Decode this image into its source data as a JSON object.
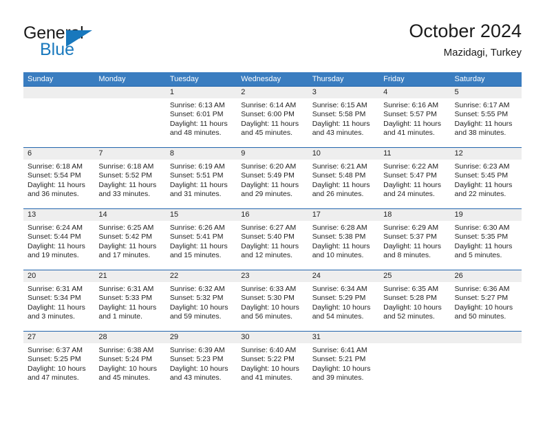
{
  "brand": {
    "line1": "General",
    "line2": "Blue",
    "accent_color": "#1878bd",
    "flag_icon": "flag-triangle-icon"
  },
  "header": {
    "title": "October 2024",
    "subtitle": "Mazidagi, Turkey"
  },
  "colors": {
    "header_bar": "#3a7dc0",
    "row_divider": "#1f62ab",
    "date_band": "#eeeeee",
    "text": "#222222"
  },
  "weekdays": [
    "Sunday",
    "Monday",
    "Tuesday",
    "Wednesday",
    "Thursday",
    "Friday",
    "Saturday"
  ],
  "weeks": [
    [
      {
        "day": "",
        "empty": true
      },
      {
        "day": "",
        "empty": true
      },
      {
        "day": "1",
        "sunrise": "Sunrise: 6:13 AM",
        "sunset": "Sunset: 6:01 PM",
        "daylight": "Daylight: 11 hours and 48 minutes."
      },
      {
        "day": "2",
        "sunrise": "Sunrise: 6:14 AM",
        "sunset": "Sunset: 6:00 PM",
        "daylight": "Daylight: 11 hours and 45 minutes."
      },
      {
        "day": "3",
        "sunrise": "Sunrise: 6:15 AM",
        "sunset": "Sunset: 5:58 PM",
        "daylight": "Daylight: 11 hours and 43 minutes."
      },
      {
        "day": "4",
        "sunrise": "Sunrise: 6:16 AM",
        "sunset": "Sunset: 5:57 PM",
        "daylight": "Daylight: 11 hours and 41 minutes."
      },
      {
        "day": "5",
        "sunrise": "Sunrise: 6:17 AM",
        "sunset": "Sunset: 5:55 PM",
        "daylight": "Daylight: 11 hours and 38 minutes."
      }
    ],
    [
      {
        "day": "6",
        "sunrise": "Sunrise: 6:18 AM",
        "sunset": "Sunset: 5:54 PM",
        "daylight": "Daylight: 11 hours and 36 minutes."
      },
      {
        "day": "7",
        "sunrise": "Sunrise: 6:18 AM",
        "sunset": "Sunset: 5:52 PM",
        "daylight": "Daylight: 11 hours and 33 minutes."
      },
      {
        "day": "8",
        "sunrise": "Sunrise: 6:19 AM",
        "sunset": "Sunset: 5:51 PM",
        "daylight": "Daylight: 11 hours and 31 minutes."
      },
      {
        "day": "9",
        "sunrise": "Sunrise: 6:20 AM",
        "sunset": "Sunset: 5:49 PM",
        "daylight": "Daylight: 11 hours and 29 minutes."
      },
      {
        "day": "10",
        "sunrise": "Sunrise: 6:21 AM",
        "sunset": "Sunset: 5:48 PM",
        "daylight": "Daylight: 11 hours and 26 minutes."
      },
      {
        "day": "11",
        "sunrise": "Sunrise: 6:22 AM",
        "sunset": "Sunset: 5:47 PM",
        "daylight": "Daylight: 11 hours and 24 minutes."
      },
      {
        "day": "12",
        "sunrise": "Sunrise: 6:23 AM",
        "sunset": "Sunset: 5:45 PM",
        "daylight": "Daylight: 11 hours and 22 minutes."
      }
    ],
    [
      {
        "day": "13",
        "sunrise": "Sunrise: 6:24 AM",
        "sunset": "Sunset: 5:44 PM",
        "daylight": "Daylight: 11 hours and 19 minutes."
      },
      {
        "day": "14",
        "sunrise": "Sunrise: 6:25 AM",
        "sunset": "Sunset: 5:42 PM",
        "daylight": "Daylight: 11 hours and 17 minutes."
      },
      {
        "day": "15",
        "sunrise": "Sunrise: 6:26 AM",
        "sunset": "Sunset: 5:41 PM",
        "daylight": "Daylight: 11 hours and 15 minutes."
      },
      {
        "day": "16",
        "sunrise": "Sunrise: 6:27 AM",
        "sunset": "Sunset: 5:40 PM",
        "daylight": "Daylight: 11 hours and 12 minutes."
      },
      {
        "day": "17",
        "sunrise": "Sunrise: 6:28 AM",
        "sunset": "Sunset: 5:38 PM",
        "daylight": "Daylight: 11 hours and 10 minutes."
      },
      {
        "day": "18",
        "sunrise": "Sunrise: 6:29 AM",
        "sunset": "Sunset: 5:37 PM",
        "daylight": "Daylight: 11 hours and 8 minutes."
      },
      {
        "day": "19",
        "sunrise": "Sunrise: 6:30 AM",
        "sunset": "Sunset: 5:35 PM",
        "daylight": "Daylight: 11 hours and 5 minutes."
      }
    ],
    [
      {
        "day": "20",
        "sunrise": "Sunrise: 6:31 AM",
        "sunset": "Sunset: 5:34 PM",
        "daylight": "Daylight: 11 hours and 3 minutes."
      },
      {
        "day": "21",
        "sunrise": "Sunrise: 6:31 AM",
        "sunset": "Sunset: 5:33 PM",
        "daylight": "Daylight: 11 hours and 1 minute."
      },
      {
        "day": "22",
        "sunrise": "Sunrise: 6:32 AM",
        "sunset": "Sunset: 5:32 PM",
        "daylight": "Daylight: 10 hours and 59 minutes."
      },
      {
        "day": "23",
        "sunrise": "Sunrise: 6:33 AM",
        "sunset": "Sunset: 5:30 PM",
        "daylight": "Daylight: 10 hours and 56 minutes."
      },
      {
        "day": "24",
        "sunrise": "Sunrise: 6:34 AM",
        "sunset": "Sunset: 5:29 PM",
        "daylight": "Daylight: 10 hours and 54 minutes."
      },
      {
        "day": "25",
        "sunrise": "Sunrise: 6:35 AM",
        "sunset": "Sunset: 5:28 PM",
        "daylight": "Daylight: 10 hours and 52 minutes."
      },
      {
        "day": "26",
        "sunrise": "Sunrise: 6:36 AM",
        "sunset": "Sunset: 5:27 PM",
        "daylight": "Daylight: 10 hours and 50 minutes."
      }
    ],
    [
      {
        "day": "27",
        "sunrise": "Sunrise: 6:37 AM",
        "sunset": "Sunset: 5:25 PM",
        "daylight": "Daylight: 10 hours and 47 minutes."
      },
      {
        "day": "28",
        "sunrise": "Sunrise: 6:38 AM",
        "sunset": "Sunset: 5:24 PM",
        "daylight": "Daylight: 10 hours and 45 minutes."
      },
      {
        "day": "29",
        "sunrise": "Sunrise: 6:39 AM",
        "sunset": "Sunset: 5:23 PM",
        "daylight": "Daylight: 10 hours and 43 minutes."
      },
      {
        "day": "30",
        "sunrise": "Sunrise: 6:40 AM",
        "sunset": "Sunset: 5:22 PM",
        "daylight": "Daylight: 10 hours and 41 minutes."
      },
      {
        "day": "31",
        "sunrise": "Sunrise: 6:41 AM",
        "sunset": "Sunset: 5:21 PM",
        "daylight": "Daylight: 10 hours and 39 minutes."
      },
      {
        "day": "",
        "empty": true
      },
      {
        "day": "",
        "empty": true
      }
    ]
  ]
}
